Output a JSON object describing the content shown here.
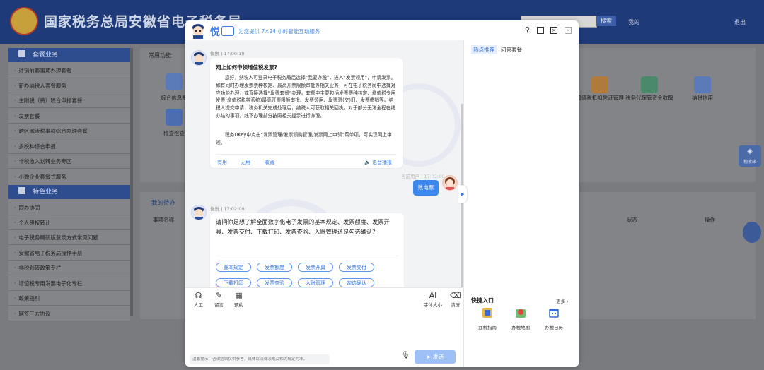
{
  "portal": {
    "title": "国家税务总局安徽省电子税务局",
    "search_label": "搜索",
    "login_text": "我的",
    "logout_label": "退出",
    "sidebar_sections": [
      {
        "title": "套餐业务",
        "items": [
          "注销前套事项办理套餐",
          "新办纳税人套餐服务",
          "主附税（费）联合申报套餐",
          "发票套餐",
          "跨区域涉税事项综合办理套餐",
          "多税种综合申报",
          "非税收入划转业务专区",
          "小微企业套餐式服务"
        ]
      },
      {
        "title": "特色业务",
        "items": [
          "同办协同",
          "个人股权转让",
          "电子税务局新版登录方式常见问题",
          "安徽省电子税务局操作手册",
          "非税划转政策专栏",
          "增值税专用发票电子化专栏",
          "政策指引",
          "网签三方协议"
        ]
      }
    ],
    "tab_common": "常用功能",
    "tab_mine": "我的待办",
    "col_name": "事项名称",
    "col_status": "状态",
    "col_action": "操作",
    "func_icons": [
      {
        "label": "综合信息报",
        "color": "#5a7ab8"
      },
      {
        "label": "稽查检查",
        "color": "#4a6eb0"
      },
      {
        "label": "增值税抵扣凭证管理",
        "color": "#b07a3a"
      },
      {
        "label": "税务代保管资金收取",
        "color": "#4a8a6a"
      },
      {
        "label": "纳税信用",
        "color": "#5a7ab8"
      }
    ],
    "side_widget": "税收政"
  },
  "chat": {
    "logo": "悦",
    "slogan": "为您提供 7×24 小时智能互动服务",
    "messages": [
      {
        "sender": "悦悦 | 17:00:18",
        "title": "网上如何申领增值税发票?",
        "paragraphs": [
          "您好，纳税人可登录电子税务局后选择“我要办税”，进入“发票领用”，申请发票。如有同时办理发票票种核定、最高开票限额审批等相关业务，可在电子税务局中选择对应功能办理，或直接选择“发票套餐”办理。套餐中主要包括发票票种核定、增值税专用发票(增值税税控系统)最高开票限额审批、发票领用、发票验(交)旧、发票缴销等。纳税人提交申请，税务机关完成处理后，纳税人可获取相关回执。对于部分无法全程在线办结的事项，线下办理部分按照相关提示进行办理。",
          "税务UKey中点击“发票管理/发票领购管理/发票网上申领”菜单项，可实现网上申领。"
        ],
        "feedback": {
          "useful": "有用",
          "useless": "无用",
          "favorite": "收藏",
          "voice": "语音播报"
        }
      },
      {
        "sender": "当前用户 | 17:02:00",
        "text": "数电票"
      },
      {
        "sender": "悦悦 | 17:02:00",
        "text": "请问你是想了解全面数字化电子发票的基本规定、发票额度、发票开具、发票交付、下载打印、发票查验、入账管理还是勾选确认?",
        "chips": [
          "基本规定",
          "发票额度",
          "发票开具",
          "发票交付",
          "下载打印",
          "发票查验",
          "入账管理",
          "勾选确认"
        ]
      }
    ],
    "tools": [
      "人工",
      "留言",
      "预约"
    ],
    "tools_right": [
      {
        "glyph": "AI",
        "label": "字体大小"
      },
      {
        "glyph": "⌫",
        "label": "清屏"
      }
    ],
    "input_placeholder": "",
    "footer_tip": "温馨提示：咨询结果仅供参考，具体以法律法规及相关规定为准。",
    "send_label": "发送",
    "right_panel": {
      "tab_hot": "热点推荐",
      "tab_qa": "问答套餐",
      "quick_title": "快捷入口",
      "more": "更多 ›",
      "quick_items": [
        "办税指南",
        "办税地图",
        "办税日历"
      ]
    }
  }
}
